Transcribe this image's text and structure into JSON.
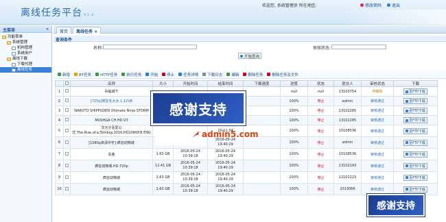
{
  "header": {
    "title": "离线任务平台",
    "version": "V1.0",
    "welcome": "欢迎您, 系统管理员  所在地区:",
    "links": [
      "修改密码",
      "退出"
    ]
  },
  "sidebar": {
    "title": "主菜单",
    "collapse": "«",
    "items": [
      {
        "label": "功能菜单",
        "level": 0,
        "icon": "folder-icon"
      },
      {
        "label": "系统管理",
        "level": 1,
        "icon": "folder-icon"
      },
      {
        "label": "机构管理",
        "level": 2,
        "icon": "file-icon"
      },
      {
        "label": "系统用户",
        "level": 2,
        "icon": "file-icon"
      },
      {
        "label": "离线下载",
        "level": 1,
        "icon": "folder-icon"
      },
      {
        "label": "下载代理",
        "level": 2,
        "icon": "file-icon"
      },
      {
        "label": "离线任务",
        "level": 2,
        "icon": "file-icon",
        "selected": true
      }
    ]
  },
  "tabs": [
    {
      "label": "首页"
    },
    {
      "label": "离线任务",
      "close": "×"
    }
  ],
  "query": {
    "title": "查询条件",
    "name_label": "名称:",
    "status_label": "审核状态:",
    "search_button": "开始查询"
  },
  "toolbar": [
    {
      "label": "新增",
      "color": "#3a9b3a"
    },
    {
      "label": "BT任务",
      "color": "#e2a200"
    },
    {
      "label": "HTTP任务",
      "color": "#3a9b3a"
    },
    {
      "label": "执行任务",
      "color": "#3a9b3a"
    },
    {
      "label": "开始",
      "color": "#2b7bd6"
    },
    {
      "label": "停止",
      "color": "#d0021b"
    },
    {
      "label": "任务详情",
      "color": "#2b7bd6"
    },
    {
      "label": "下载日志",
      "color": "#888"
    },
    {
      "label": "编辑",
      "color": "#3a9b3a"
    },
    {
      "label": "删除任务",
      "color": "#d0021b"
    },
    {
      "label": "删除任务及文件",
      "color": "#d0021b"
    }
  ],
  "table": {
    "columns": [
      "",
      "",
      "名称",
      "大小",
      "开始时间",
      "结束时间",
      "下载速度",
      "进度",
      "状态",
      "提交人",
      "审核状态",
      "下载"
    ],
    "rows": [
      {
        "no": "1",
        "name": "兵临城下",
        "size": "",
        "start": "",
        "end": "",
        "speed": "",
        "progress": "null",
        "state": "null",
        "user": "13103754",
        "audit": "待审核",
        "dl": "至FTP下载"
      },
      {
        "no": "2",
        "name": "[720p]疯狂毛大太.1.12VB",
        "size": "1.64",
        "start": "",
        "end": "",
        "speed": "",
        "progress": "100%",
        "state": "停止",
        "user": "admin",
        "audit": "审核通过",
        "dl": "至FTP下载"
      },
      {
        "no": "3",
        "name": "NARUTO SHIPPUDEN Ultimate Ninja STORM",
        "size": "32.2",
        "start": "",
        "end": "",
        "speed": "",
        "progress": "100%",
        "state": "停止",
        "user": "13102285",
        "audit": "审核通过",
        "dl": "至FTP下载"
      },
      {
        "no": "4",
        "name": "MUSHGA CH.HD.V3",
        "size": "33.4",
        "start": "",
        "end": "",
        "speed": "",
        "progress": "100%",
        "state": "停止",
        "user": "13102285",
        "audit": "审核通过",
        "dl": "至FTP下载"
      },
      {
        "no": "5",
        "name": "次元子喜爱公式.The.Rise.of.a.Tomboy.2016.HD1080P.B ENG",
        "size": "1.63 GB",
        "start": "08:52:00",
        "end": "20:11:34",
        "speed": "",
        "progress": "100%",
        "state": "停止",
        "user": "15108536",
        "audit": "审核通过",
        "dl": "至FTP下载"
      },
      {
        "no": "6",
        "name": "[1080p高清中字]-疯狂动物城",
        "size": "1.63 GB",
        "start": "2016-05-24 10:39:18",
        "end": "2016-05-24 19:40:29",
        "speed": "",
        "progress": "100%",
        "state": "停止",
        "user": "admin",
        "audit": "审核通过",
        "dl": "至FTP下载"
      },
      {
        "no": "7",
        "name": "玄奘",
        "size": "1.63 GB",
        "start": "2016-05-24 10:39:18",
        "end": "2016-05-24 19:40:29",
        "speed": "",
        "progress": "100%",
        "state": "停止",
        "user": "15108536",
        "audit": "审核通过",
        "dl": "至FTP下载"
      },
      {
        "no": "8",
        "name": "疯狂动物城.HD.720p",
        "size": "12.41 GB",
        "start": "2016-05-24 10:39:18",
        "end": "2016-05-24 19:40:29",
        "speed": "",
        "progress": "100%",
        "state": "停止",
        "user": "13102193",
        "audit": "审核通过",
        "dl": "至FTP下载"
      },
      {
        "no": "9",
        "name": "疯狂动物城",
        "size": "1.63 GB",
        "start": "2016-05-24 10:39:18",
        "end": "2016-05-24 19:40:29",
        "speed": "",
        "progress": "100%",
        "state": "停止",
        "user": "12101223",
        "audit": "审核通过",
        "dl": "至FTP下载"
      },
      {
        "no": "10",
        "name": "疯狂动物城",
        "size": "1.63 GB",
        "start": "2016-05-24 10:39:18",
        "end": "2016-05-24 19:40:29",
        "speed": "",
        "progress": "100%",
        "state": "停止",
        "user": "2013066",
        "audit": "审核通过",
        "dl": "至FTP下载"
      }
    ]
  },
  "overlays": {
    "thanks": "感谢支持",
    "site": "admin5.com"
  }
}
